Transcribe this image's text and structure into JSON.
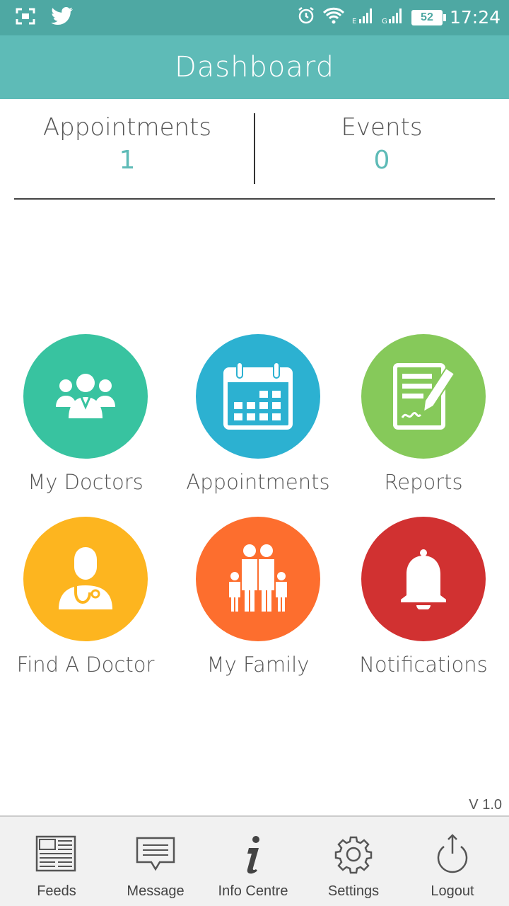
{
  "status_bar": {
    "time": "17:24",
    "battery": "52"
  },
  "app_bar": {
    "title": "Dashboard"
  },
  "counters": {
    "appointments_label": "Appointments",
    "appointments_value": "1",
    "events_label": "Events",
    "events_value": "0"
  },
  "tiles": [
    {
      "label": "My Doctors",
      "color": "#38c3a0",
      "icon": "doctors-group-icon"
    },
    {
      "label": "Appointments",
      "color": "#2cb1d1",
      "icon": "calendar-icon"
    },
    {
      "label": "Reports",
      "color": "#86c95a",
      "icon": "report-signature-icon"
    },
    {
      "label": "Find A Doctor",
      "color": "#fdb51f",
      "icon": "doctor-stethoscope-icon"
    },
    {
      "label": "My Family",
      "color": "#fd6e2e",
      "icon": "family-icon"
    },
    {
      "label": "Notifications",
      "color": "#d13131",
      "icon": "bell-icon"
    }
  ],
  "version": "V 1.0",
  "bottom_nav": [
    {
      "label": "Feeds",
      "icon": "newspaper-icon"
    },
    {
      "label": "Message",
      "icon": "message-icon"
    },
    {
      "label": "Info Centre",
      "icon": "info-icon"
    },
    {
      "label": "Settings",
      "icon": "gear-icon"
    },
    {
      "label": "Logout",
      "icon": "power-icon"
    }
  ]
}
